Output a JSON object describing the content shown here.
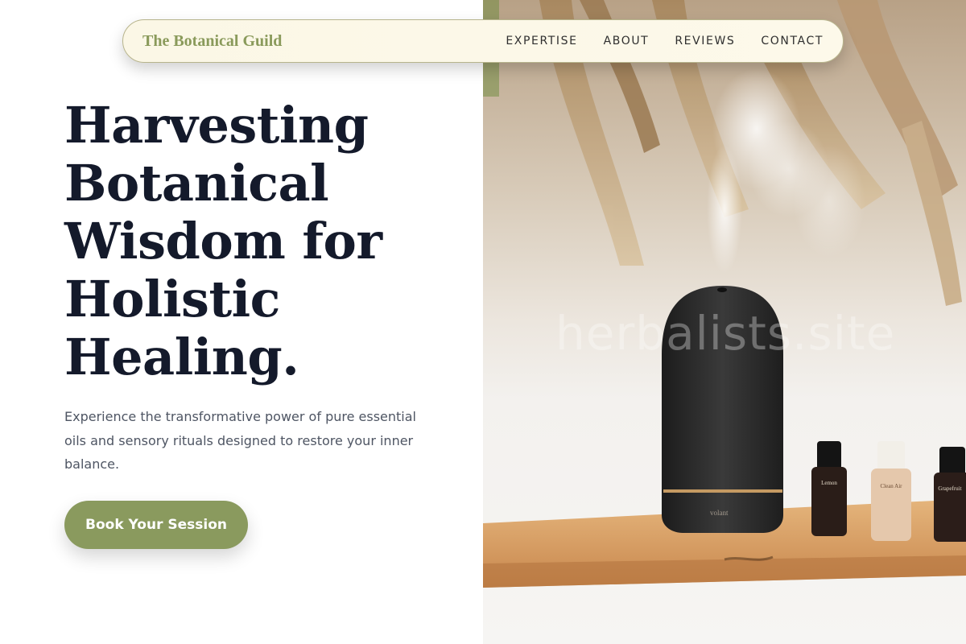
{
  "nav": {
    "brand": "The Botanical Guild",
    "links": [
      "EXPERTISE",
      "ABOUT",
      "REVIEWS",
      "CONTACT"
    ]
  },
  "hero": {
    "headline_lines": [
      "Harvesting",
      "Botanical",
      "Wisdom for",
      "Holistic",
      "Healing."
    ],
    "subtitle": "Experience the transformative power of pure essential oils and sensory rituals designed to restore your inner balance.",
    "cta_label": "Book Your Session"
  },
  "photo": {
    "watermark": "herbalists.site",
    "diffuser_brand": "volant",
    "bottles": [
      {
        "label": "Lemon",
        "maker": "volant"
      },
      {
        "label": "Clean Air",
        "maker": "volant"
      },
      {
        "label": "Grapefruit",
        "maker": "volant"
      }
    ]
  },
  "colors": {
    "accent": "#8a9a5e",
    "brand_text": "#8a9a5b",
    "headline": "#141a2b",
    "body_text": "#4e5563",
    "nav_bg": "#fbf7e6"
  }
}
